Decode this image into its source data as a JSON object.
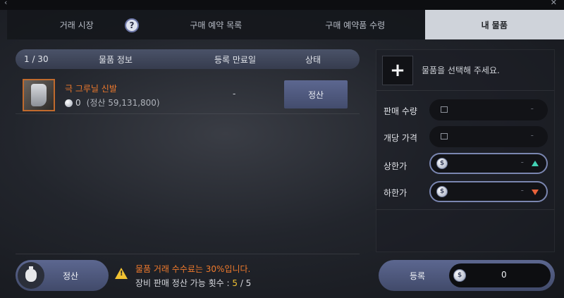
{
  "tabs": [
    {
      "label": "거래 시장"
    },
    {
      "label": "구매 예약 목록"
    },
    {
      "label": "구매 예약품 수령"
    },
    {
      "label": "내 물품"
    }
  ],
  "help_icon": "?",
  "list": {
    "count": "1 / 30",
    "col_info": "물품 정보",
    "col_date": "등록 만료일",
    "col_state": "상태",
    "item": {
      "name": "극 그루닐 신발",
      "amount": "0",
      "settle_note": "(정산 59,131,800)",
      "date": "-",
      "settle_label": "정산"
    }
  },
  "footer_left": {
    "settle_label": "정산",
    "fee_text": "물품 거래 수수료는 30%입니다.",
    "limit_label": "장비 판매 정산 가능 횟수 :",
    "limit_current": "5",
    "limit_sep": " / ",
    "limit_max": "5"
  },
  "panel": {
    "select_prompt": "물품을 선택해 주세요.",
    "plus": "+",
    "rows": {
      "qty_label": "판매 수량",
      "unit_label": "개당 가격",
      "upper_label": "상한가",
      "lower_label": "하한가",
      "dash": "-",
      "coin": "$"
    }
  },
  "register": {
    "label": "등록",
    "amount": "0",
    "coin": "$"
  },
  "colors": {
    "accent_orange": "#f07a2c",
    "warn_yellow": "#f1c232",
    "up_green": "#42d1b4",
    "down_red": "#e8623a"
  }
}
